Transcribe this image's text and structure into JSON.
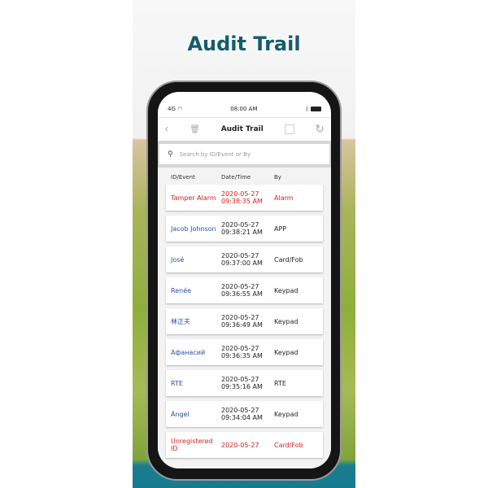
{
  "page_title": "Audit Trail",
  "status": {
    "network": "4G",
    "time": "08:00 AM"
  },
  "nav": {
    "title": "Audit Trail"
  },
  "search": {
    "placeholder": "Search by ID/Event or By"
  },
  "columns": [
    "ID/Event",
    "Date/Time",
    "By"
  ],
  "rows": [
    {
      "id": "Tamper Alarm",
      "date": "2020-05-27",
      "time": "09:38:35 AM",
      "by": "Alarm",
      "alert": true
    },
    {
      "id": "Jacob Johnson",
      "date": "2020-05-27",
      "time": "09:38:21 AM",
      "by": "APP",
      "alert": false
    },
    {
      "id": "José",
      "date": "2020-05-27",
      "time": "09:37:00 AM",
      "by": "Card/Fob",
      "alert": false
    },
    {
      "id": "Renée",
      "date": "2020-05-27",
      "time": "09:36:55 AM",
      "by": "Keypad",
      "alert": false
    },
    {
      "id": "林正夫",
      "date": "2020-05-27",
      "time": "09:36:49 AM",
      "by": "Keypad",
      "alert": false
    },
    {
      "id": "Афанасий",
      "date": "2020-05-27",
      "time": "09:36:35 AM",
      "by": "Keypad",
      "alert": false
    },
    {
      "id": "RTE",
      "date": "2020-05-27",
      "time": "09:35:16 AM",
      "by": "RTE",
      "alert": false
    },
    {
      "id": "Ángel",
      "date": "2020-05-27",
      "time": "09:34:04 AM",
      "by": "Keypad",
      "alert": false
    },
    {
      "id": "Unregistered ID",
      "date": "2020-05-27",
      "time": "",
      "by": "Card/Fob",
      "alert": true
    }
  ],
  "colors": {
    "title": "#145c6e",
    "alert": "#d42020",
    "name": "#2a4fa0"
  }
}
